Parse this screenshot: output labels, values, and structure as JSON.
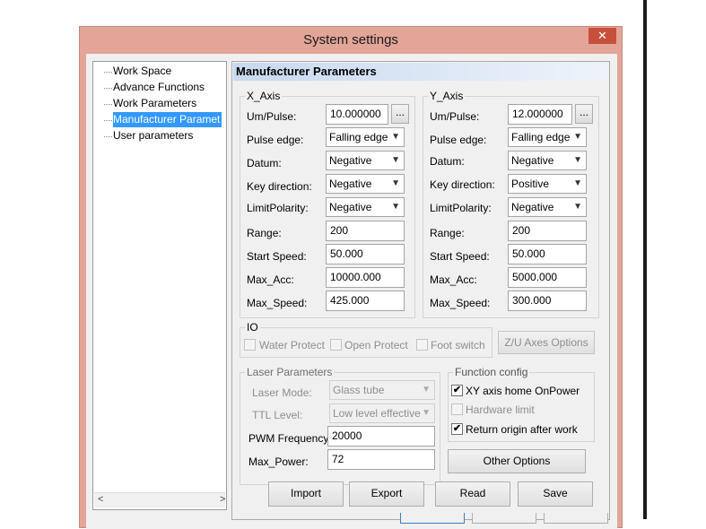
{
  "window": {
    "title": "System settings",
    "close_glyph": "✕"
  },
  "tree": {
    "items": [
      "Work Space",
      "Advance Functions",
      "Work Parameters",
      "Manufacturer Paramet",
      "User parameters"
    ],
    "scroll_left": "<",
    "scroll_right": ">"
  },
  "panel": {
    "header": "Manufacturer Parameters"
  },
  "x_axis": {
    "title": "X_Axis",
    "labels": {
      "um_pulse": "Um/Pulse:",
      "pulse_edge": "Pulse edge:",
      "datum": "Datum:",
      "key_direction": "Key direction:",
      "limit_polarity": "LimitPolarity:",
      "range": "Range:",
      "start_speed": "Start Speed:",
      "max_acc": "Max_Acc:",
      "max_speed": "Max_Speed:"
    },
    "values": {
      "um_pulse": "10.000000",
      "pulse_edge": "Falling edge",
      "datum": "Negative",
      "key_direction": "Negative",
      "limit_polarity": "Negative",
      "range": "200",
      "start_speed": "50.000",
      "max_acc": "10000.000",
      "max_speed": "425.000"
    },
    "browse": "..."
  },
  "y_axis": {
    "title": "Y_Axis",
    "labels": {
      "um_pulse": "Um/Pulse:",
      "pulse_edge": "Pulse edge:",
      "datum": "Datum:",
      "key_direction": "Key direction:",
      "limit_polarity": "LimitPolarity:",
      "range": "Range:",
      "start_speed": "Start Speed:",
      "max_acc": "Max_Acc:",
      "max_speed": "Max_Speed:"
    },
    "values": {
      "um_pulse": "12.000000",
      "pulse_edge": "Falling edge",
      "datum": "Negative",
      "key_direction": "Positive",
      "limit_polarity": "Negative",
      "range": "200",
      "start_speed": "50.000",
      "max_acc": "5000.000",
      "max_speed": "300.000"
    },
    "browse": "..."
  },
  "io": {
    "title": "IO",
    "water_protect": "Water Protect",
    "open_protect": "Open Protect",
    "foot_switch": "Foot switch"
  },
  "zu_button": "Z/U Axes Options",
  "laser": {
    "title": "Laser Parameters",
    "laser_mode_label": "Laser Mode:",
    "laser_mode": "Glass tube",
    "ttl_label": "TTL Level:",
    "ttl": "Low level effective",
    "pwm_label": "PWM Frequency:",
    "pwm": "20000",
    "max_power_label": "Max_Power:",
    "max_power": "72"
  },
  "function_config": {
    "title": "Function config",
    "xy_home": "XY axis home OnPower",
    "xy_home_checked": true,
    "hardware_limit": "Hardware limit",
    "hardware_limit_checked": false,
    "return_origin": "Return origin after work",
    "return_origin_checked": true,
    "check_glyph": "✔"
  },
  "buttons": {
    "other_options": "Other Options",
    "import": "Import",
    "export": "Export",
    "read": "Read",
    "save": "Save"
  }
}
